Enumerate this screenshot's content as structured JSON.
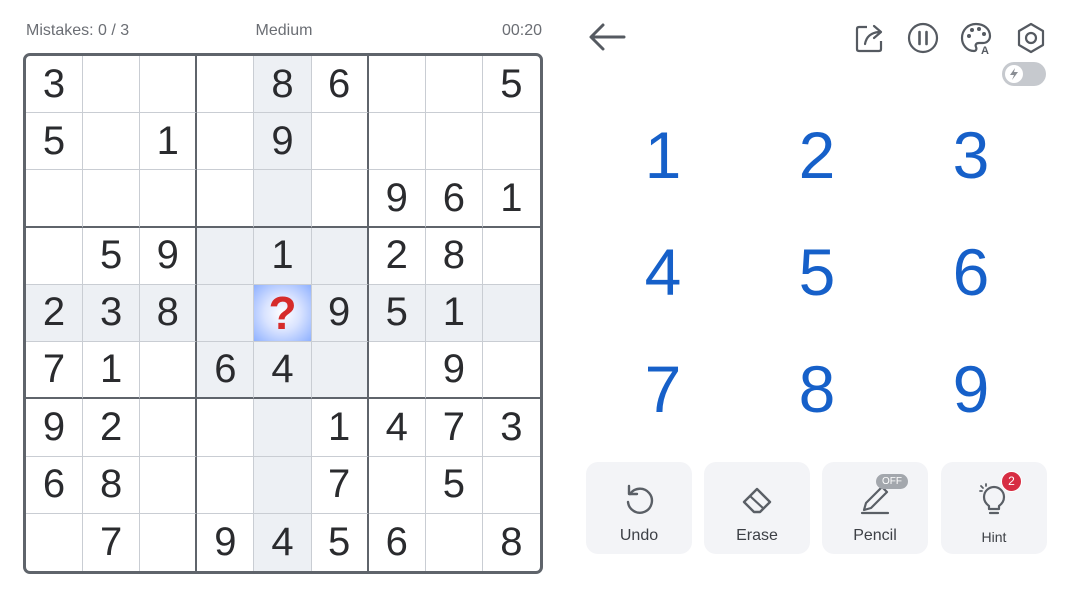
{
  "status": {
    "mistakes": "Mistakes: 0 / 3",
    "difficulty": "Medium",
    "timer": "00:20"
  },
  "board": {
    "rows": [
      [
        "3",
        "",
        "",
        "",
        "8",
        "6",
        "",
        "",
        "5"
      ],
      [
        "5",
        "",
        "1",
        "",
        "9",
        "",
        "",
        "",
        ""
      ],
      [
        "",
        "",
        "",
        "",
        "",
        "",
        "9",
        "6",
        "1"
      ],
      [
        "",
        "5",
        "9",
        "",
        "1",
        "",
        "2",
        "8",
        ""
      ],
      [
        "2",
        "3",
        "8",
        "",
        "?",
        "9",
        "5",
        "1",
        ""
      ],
      [
        "7",
        "1",
        "",
        "6",
        "4",
        "",
        "",
        "9",
        ""
      ],
      [
        "9",
        "2",
        "",
        "",
        "",
        "1",
        "4",
        "7",
        "3"
      ],
      [
        "6",
        "8",
        "",
        "",
        "",
        "7",
        "",
        "5",
        ""
      ],
      [
        "",
        "7",
        "",
        "9",
        "4",
        "5",
        "6",
        "",
        "8"
      ]
    ],
    "selected_cell": "?"
  },
  "toolbar": {
    "icons": [
      "back-arrow-icon",
      "share-icon",
      "pause-icon",
      "palette-icon",
      "settings-icon",
      "lightning-toggle-icon"
    ],
    "toggle_state": "off"
  },
  "numpad": [
    "1",
    "2",
    "3",
    "4",
    "5",
    "6",
    "7",
    "8",
    "9"
  ],
  "tools": {
    "undo": "Undo",
    "erase": "Erase",
    "pencil": "Pencil",
    "pencil_badge": "OFF",
    "hint": "Hint",
    "hint_badge": "2"
  },
  "colors": {
    "number_blue": "#1660c9",
    "board_border": "#5f646b",
    "highlight": "#edf0f4",
    "selected_mark": "#d62b2b",
    "badge_red": "#d72d43"
  }
}
